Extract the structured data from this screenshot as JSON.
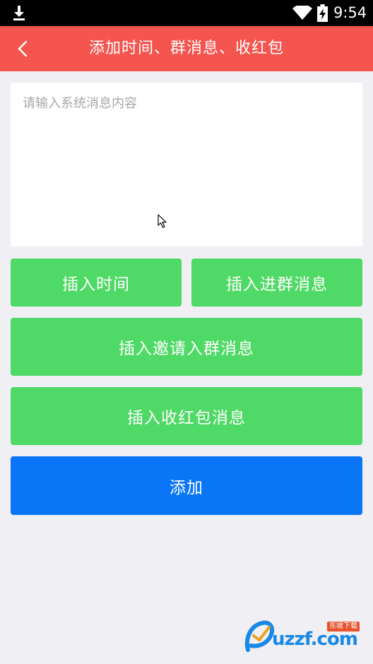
{
  "status_bar": {
    "time": "9:54",
    "icons": [
      "download-icon",
      "wifi-icon",
      "battery-charging-icon"
    ]
  },
  "header": {
    "title": "添加时间、群消息、收红包",
    "back_icon": "chevron-left-icon",
    "background_color": "#f5554f"
  },
  "message_input": {
    "value": "",
    "placeholder": "请输入系统消息内容"
  },
  "buttons": {
    "insert_time": "插入时间",
    "insert_join_message": "插入进群消息",
    "insert_invite_message": "插入邀请入群消息",
    "insert_red_packet_message": "插入收红包消息",
    "add": "添加"
  },
  "colors": {
    "insert_button": "#4fd966",
    "add_button": "#0a76f7",
    "page_background": "#efeff4"
  },
  "watermark": {
    "text": "uzzf.com",
    "tag": "东坡下载"
  }
}
